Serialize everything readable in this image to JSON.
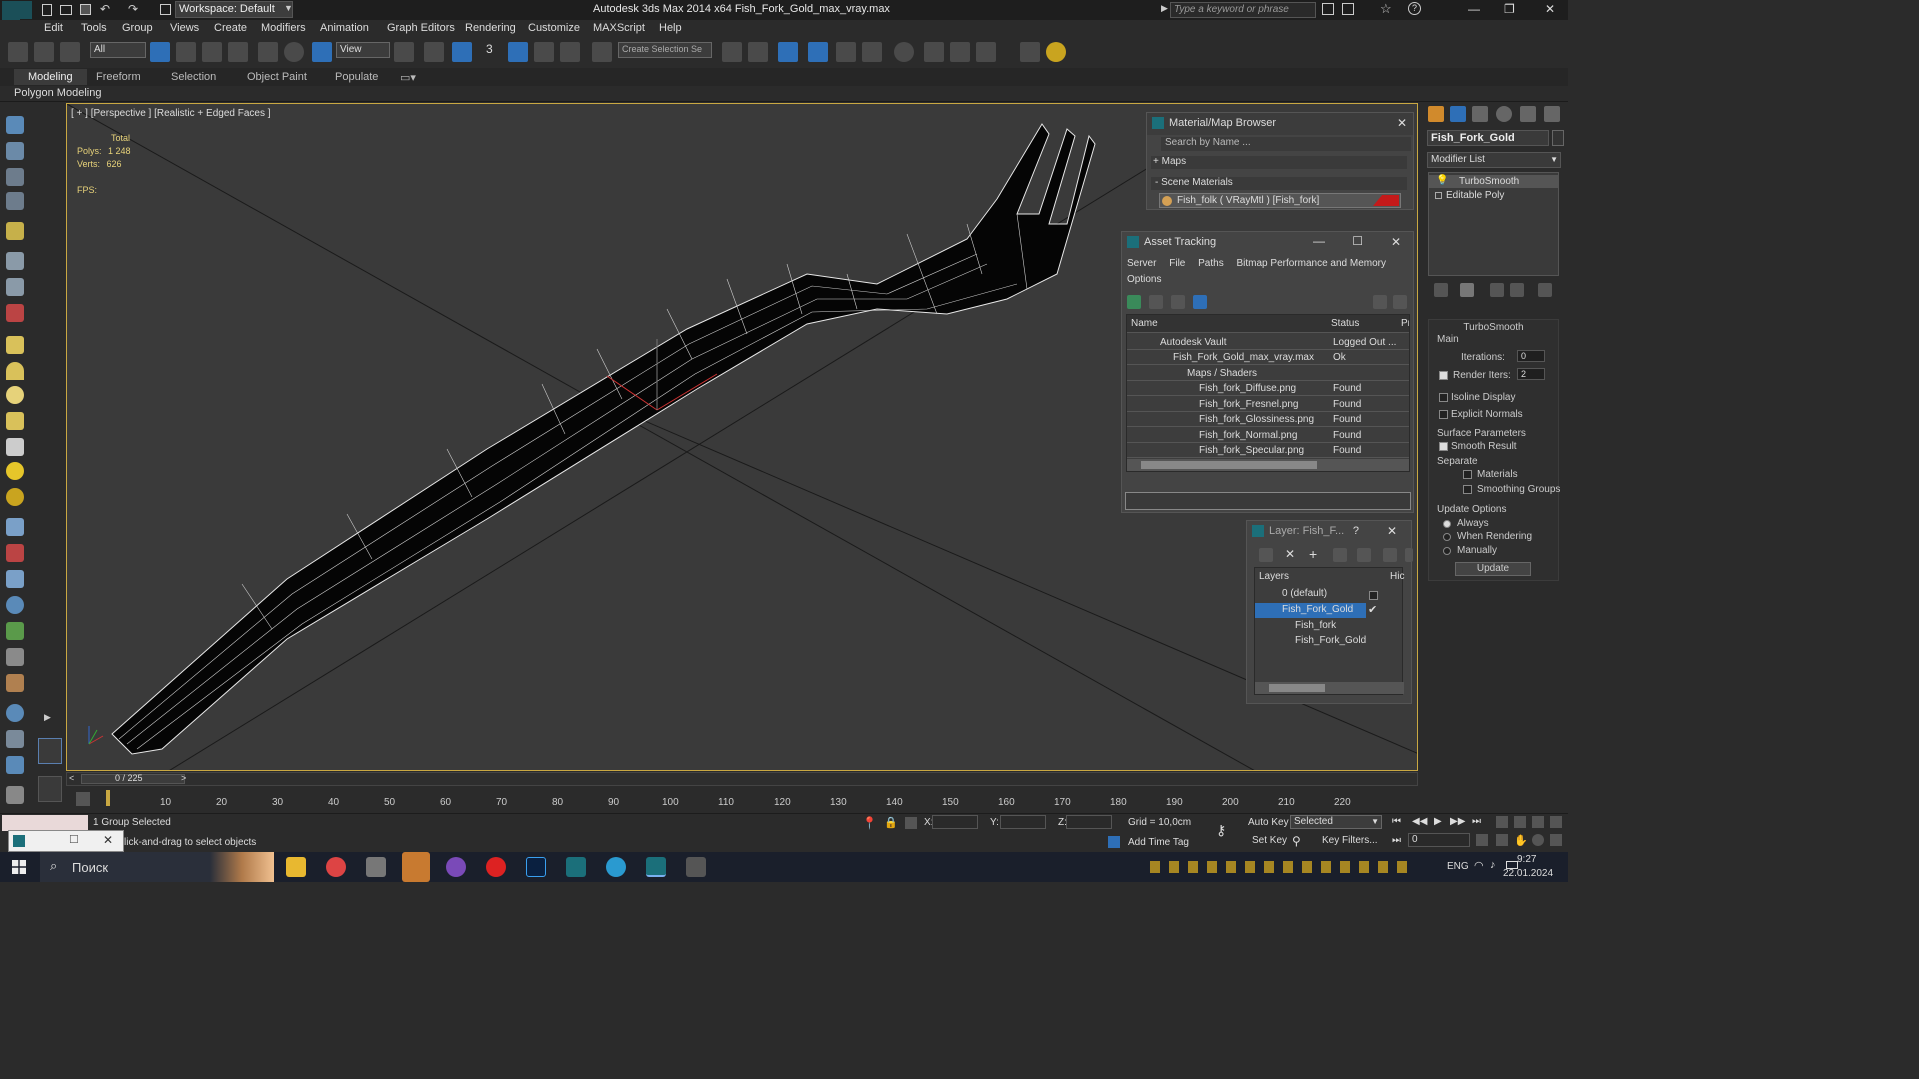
{
  "titlebar": {
    "app_title": "Autodesk 3ds Max  2014 x64     Fish_Fork_Gold_max_vray.max",
    "workspace": "Workspace: Default",
    "search_placeholder": "Type a keyword or phrase"
  },
  "menu": [
    "Edit",
    "Tools",
    "Group",
    "Views",
    "Create",
    "Modifiers",
    "Animation",
    "Graph Editors",
    "Rendering",
    "Customize",
    "MAXScript",
    "Help"
  ],
  "toolbar": {
    "selection_filter": "All",
    "ref_coord": "View",
    "named_selection": "Create Selection Se",
    "snap_label": "3"
  },
  "ribbon": {
    "tabs": [
      "Modeling",
      "Freeform",
      "Selection",
      "Object Paint",
      "Populate"
    ],
    "active_tab": "Modeling",
    "sub_label": "Polygon Modeling"
  },
  "viewport": {
    "label": "[ + ] [Perspective ] [Realistic + Edged Faces ]",
    "stats": {
      "total_label": "Total",
      "polys_label": "Polys:",
      "polys_value": "1 248",
      "verts_label": "Verts:",
      "verts_value": "626",
      "fps_label": "FPS:"
    }
  },
  "material_browser": {
    "title": "Material/Map Browser",
    "search_placeholder": "Search by Name ...",
    "maps_label": "+ Maps",
    "scene_materials_label": "- Scene Materials",
    "material_item": "Fish_folk ( VRayMtl ) [Fish_fork]"
  },
  "asset_tracking": {
    "title": "Asset Tracking",
    "menu": [
      "Server",
      "File",
      "Paths",
      "Bitmap Performance and Memory"
    ],
    "menu2": "Options",
    "columns": {
      "name": "Name",
      "status": "Status",
      "extra": "Pr"
    },
    "rows": [
      {
        "name": "Autodesk Vault",
        "status": "Logged Out ..."
      },
      {
        "name": "Fish_Fork_Gold_max_vray.max",
        "status": "Ok"
      },
      {
        "name": "Maps / Shaders",
        "status": ""
      },
      {
        "name": "Fish_fork_Diffuse.png",
        "status": "Found"
      },
      {
        "name": "Fish_fork_Fresnel.png",
        "status": "Found"
      },
      {
        "name": "Fish_fork_Glossiness.png",
        "status": "Found"
      },
      {
        "name": "Fish_fork_Normal.png",
        "status": "Found"
      },
      {
        "name": "Fish_fork_Specular.png",
        "status": "Found"
      }
    ]
  },
  "layer_explorer": {
    "title": "Layer: Fish_F...",
    "help": "?",
    "col_layers": "Layers",
    "col_hide": "Hic",
    "rows": [
      {
        "name": "0 (default)",
        "level": 0
      },
      {
        "name": "Fish_Fork_Gold",
        "level": 0,
        "selected": true
      },
      {
        "name": "Fish_fork",
        "level": 1
      },
      {
        "name": "Fish_Fork_Gold",
        "level": 1
      }
    ]
  },
  "command_panel": {
    "object_name": "Fish_Fork_Gold",
    "modifier_list": "Modifier List",
    "stack": [
      "TurboSmooth",
      "Editable Poly"
    ],
    "turbosmooth": {
      "title": "TurboSmooth",
      "main": "Main",
      "iterations_label": "Iterations:",
      "iterations_value": "0",
      "render_iters_label": "Render Iters:",
      "render_iters_value": "2",
      "isoline": "Isoline Display",
      "explicit_normals": "Explicit Normals",
      "surface_params": "Surface Parameters",
      "smooth_result": "Smooth Result",
      "separate": "Separate",
      "materials": "Materials",
      "smoothing_groups": "Smoothing Groups",
      "update_options": "Update Options",
      "always": "Always",
      "when_rendering": "When Rendering",
      "manually": "Manually",
      "update_button": "Update"
    }
  },
  "timeline": {
    "frame": "0 / 225",
    "ticks": [
      "10",
      "20",
      "30",
      "40",
      "50",
      "60",
      "70",
      "80",
      "90",
      "100",
      "110",
      "120",
      "130",
      "140",
      "150",
      "160",
      "170",
      "180",
      "190",
      "200",
      "210",
      "220"
    ]
  },
  "status": {
    "selected": "1 Group Selected",
    "prompt": "lick-and-drag to select objects",
    "x_label": "X:",
    "y_label": "Y:",
    "z_label": "Z:",
    "grid": "Grid = 10,0cm",
    "add_time_tag": "Add Time Tag",
    "auto_key": "Auto Key",
    "set_key": "Set Key",
    "selected_dropdown": "Selected",
    "key_filters": "Key Filters...",
    "frame_field": "0"
  },
  "taskbar": {
    "search": "Поиск",
    "lang": "ENG",
    "time": "9:27",
    "date": "22.01.2024"
  }
}
